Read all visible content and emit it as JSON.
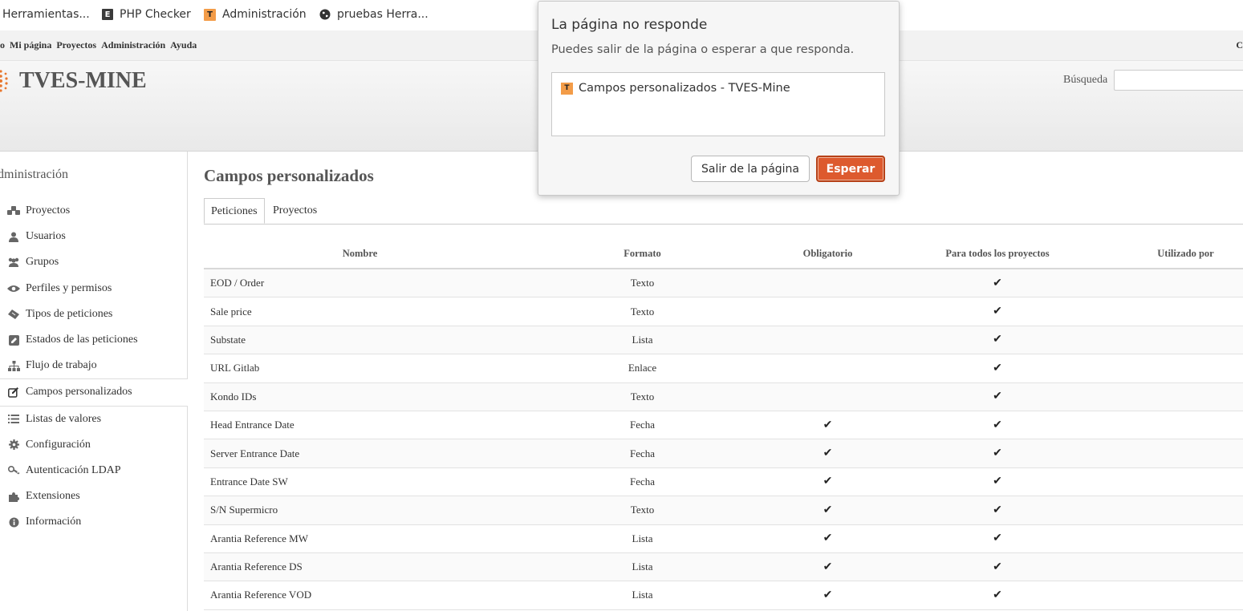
{
  "bookmarks": [
    {
      "label": "Herramientas...",
      "icon": "none"
    },
    {
      "label": "PHP Checker",
      "icon": "e-square-icon"
    },
    {
      "label": "Administración",
      "icon": "t-favicon-icon"
    },
    {
      "label": "pruebas Herra...",
      "icon": "globe-icon"
    }
  ],
  "top_menu": {
    "links": [
      "o",
      "Mi página",
      "Proyectos",
      "Administración",
      "Ayuda"
    ],
    "right_text": "C"
  },
  "header": {
    "site_title": "TVES-MINE",
    "search_label": "Búsqueda",
    "search_value": ""
  },
  "sidebar": {
    "title": "dministración",
    "items": [
      {
        "label": "Proyectos",
        "icon": "projects-icon"
      },
      {
        "label": "Usuarios",
        "icon": "user-icon"
      },
      {
        "label": "Grupos",
        "icon": "group-icon"
      },
      {
        "label": "Perfiles y permisos",
        "icon": "eye-icon"
      },
      {
        "label": "Tipos de peticiones",
        "icon": "ticket-icon"
      },
      {
        "label": "Estados de las peticiones",
        "icon": "edit-square-icon"
      },
      {
        "label": "Flujo de trabajo",
        "icon": "sitemap-icon"
      },
      {
        "label": "Campos personalizados",
        "icon": "pencil-square-icon",
        "active": true
      },
      {
        "label": "Listas de valores",
        "icon": "list-icon"
      },
      {
        "label": "Configuración",
        "icon": "gear-icon"
      },
      {
        "label": "Autenticación LDAP",
        "icon": "key-icon"
      },
      {
        "label": "Extensiones",
        "icon": "puzzle-icon"
      },
      {
        "label": "Información",
        "icon": "info-icon"
      }
    ]
  },
  "main": {
    "title": "Campos personalizados",
    "tabs": [
      "Peticiones",
      "Proyectos"
    ],
    "columns": [
      "Nombre",
      "Formato",
      "Obligatorio",
      "Para todos los proyectos",
      "Utilizado por"
    ],
    "rows": [
      {
        "name": "EOD / Order",
        "format": "Texto",
        "required": false,
        "all_projects": true
      },
      {
        "name": "Sale price",
        "format": "Texto",
        "required": false,
        "all_projects": true
      },
      {
        "name": "Substate",
        "format": "Lista",
        "required": false,
        "all_projects": true
      },
      {
        "name": "URL Gitlab",
        "format": "Enlace",
        "required": false,
        "all_projects": true
      },
      {
        "name": "Kondo IDs",
        "format": "Texto",
        "required": false,
        "all_projects": true
      },
      {
        "name": "Head Entrance Date",
        "format": "Fecha",
        "required": true,
        "all_projects": true
      },
      {
        "name": "Server Entrance Date",
        "format": "Fecha",
        "required": true,
        "all_projects": true
      },
      {
        "name": "Entrance Date SW",
        "format": "Fecha",
        "required": true,
        "all_projects": true
      },
      {
        "name": "S/N Supermicro",
        "format": "Texto",
        "required": true,
        "all_projects": true
      },
      {
        "name": "Arantia Reference MW",
        "format": "Lista",
        "required": true,
        "all_projects": true
      },
      {
        "name": "Arantia Reference DS",
        "format": "Lista",
        "required": true,
        "all_projects": true
      },
      {
        "name": "Arantia Reference VOD",
        "format": "Lista",
        "required": true,
        "all_projects": true
      }
    ]
  },
  "dialog": {
    "title": "La página no responde",
    "message": "Puedes salir de la página o esperar a que responda.",
    "page_item": "Campos personalizados - TVES-Mine",
    "leave_button": "Salir de la página",
    "wait_button": "Esperar",
    "accent_color": "#dd5a2e"
  }
}
